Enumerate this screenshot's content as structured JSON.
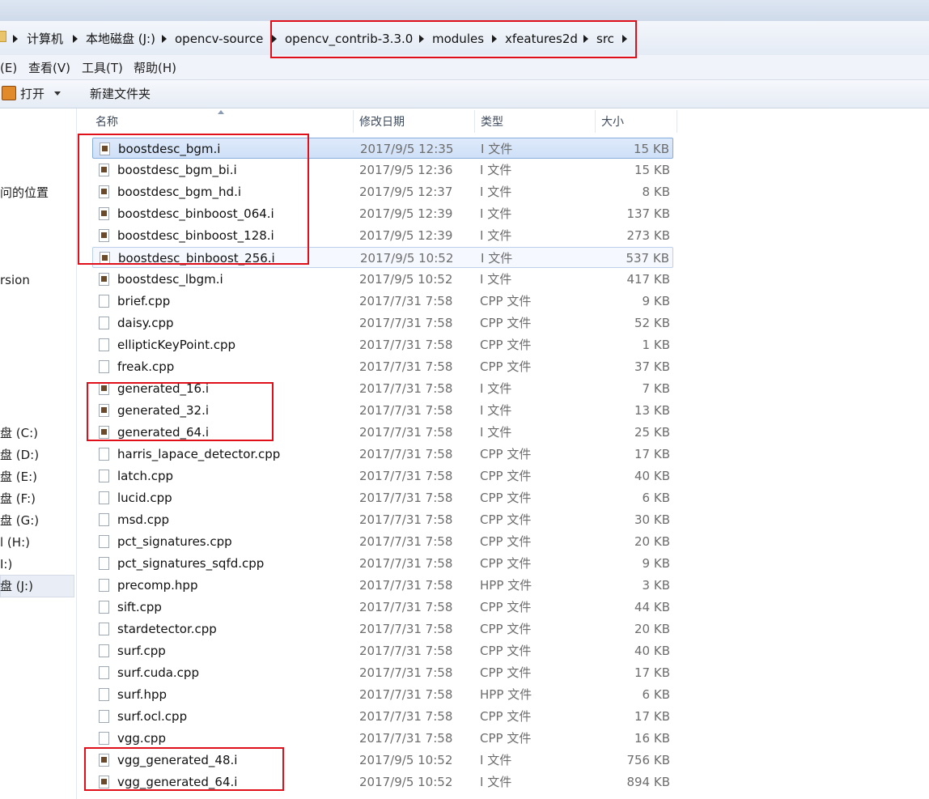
{
  "breadcrumb": {
    "items": [
      "计算机",
      "本地磁盘 (J:)",
      "opencv-source",
      "opencv_contrib-3.3.0",
      "modules",
      "xfeatures2d",
      "src"
    ]
  },
  "menu": {
    "items": [
      "(E)",
      "查看(V)",
      "工具(T)",
      "帮助(H)"
    ]
  },
  "toolbar": {
    "open_label": "打开",
    "new_folder_label": "新建文件夹"
  },
  "nav": {
    "items": [
      "问的位置",
      "rsion",
      "盘 (C:)",
      "盘 (D:)",
      "盘 (E:)",
      "盘 (F:)",
      "盘 (G:)",
      "l (H:)",
      "I:)",
      "盘 (J:)"
    ]
  },
  "columns": {
    "name": "名称",
    "date": "修改日期",
    "type": "类型",
    "size": "大小"
  },
  "files": [
    {
      "name": "boostdesc_bgm.i",
      "date": "2017/9/5 12:35",
      "type": "I 文件",
      "size": "15 KB",
      "icon": "data-file-icon",
      "state": "selected"
    },
    {
      "name": "boostdesc_bgm_bi.i",
      "date": "2017/9/5 12:36",
      "type": "I 文件",
      "size": "15 KB",
      "icon": "data-file-icon"
    },
    {
      "name": "boostdesc_bgm_hd.i",
      "date": "2017/9/5 12:37",
      "type": "I 文件",
      "size": "8 KB",
      "icon": "data-file-icon"
    },
    {
      "name": "boostdesc_binboost_064.i",
      "date": "2017/9/5 12:39",
      "type": "I 文件",
      "size": "137 KB",
      "icon": "data-file-icon"
    },
    {
      "name": "boostdesc_binboost_128.i",
      "date": "2017/9/5 12:39",
      "type": "I 文件",
      "size": "273 KB",
      "icon": "data-file-icon"
    },
    {
      "name": "boostdesc_binboost_256.i",
      "date": "2017/9/5 10:52",
      "type": "I 文件",
      "size": "537 KB",
      "icon": "data-file-icon",
      "state": "hover"
    },
    {
      "name": "boostdesc_lbgm.i",
      "date": "2017/9/5 10:52",
      "type": "I 文件",
      "size": "417 KB",
      "icon": "data-file-icon"
    },
    {
      "name": "brief.cpp",
      "date": "2017/7/31 7:58",
      "type": "CPP 文件",
      "size": "9 KB",
      "icon": "source-file-icon"
    },
    {
      "name": "daisy.cpp",
      "date": "2017/7/31 7:58",
      "type": "CPP 文件",
      "size": "52 KB",
      "icon": "source-file-icon"
    },
    {
      "name": "ellipticKeyPoint.cpp",
      "date": "2017/7/31 7:58",
      "type": "CPP 文件",
      "size": "1 KB",
      "icon": "source-file-icon"
    },
    {
      "name": "freak.cpp",
      "date": "2017/7/31 7:58",
      "type": "CPP 文件",
      "size": "37 KB",
      "icon": "source-file-icon"
    },
    {
      "name": "generated_16.i",
      "date": "2017/7/31 7:58",
      "type": "I 文件",
      "size": "7 KB",
      "icon": "data-file-icon"
    },
    {
      "name": "generated_32.i",
      "date": "2017/7/31 7:58",
      "type": "I 文件",
      "size": "13 KB",
      "icon": "data-file-icon"
    },
    {
      "name": "generated_64.i",
      "date": "2017/7/31 7:58",
      "type": "I 文件",
      "size": "25 KB",
      "icon": "data-file-icon"
    },
    {
      "name": "harris_lapace_detector.cpp",
      "date": "2017/7/31 7:58",
      "type": "CPP 文件",
      "size": "17 KB",
      "icon": "source-file-icon"
    },
    {
      "name": "latch.cpp",
      "date": "2017/7/31 7:58",
      "type": "CPP 文件",
      "size": "40 KB",
      "icon": "source-file-icon"
    },
    {
      "name": "lucid.cpp",
      "date": "2017/7/31 7:58",
      "type": "CPP 文件",
      "size": "6 KB",
      "icon": "source-file-icon"
    },
    {
      "name": "msd.cpp",
      "date": "2017/7/31 7:58",
      "type": "CPP 文件",
      "size": "30 KB",
      "icon": "source-file-icon"
    },
    {
      "name": "pct_signatures.cpp",
      "date": "2017/7/31 7:58",
      "type": "CPP 文件",
      "size": "20 KB",
      "icon": "source-file-icon"
    },
    {
      "name": "pct_signatures_sqfd.cpp",
      "date": "2017/7/31 7:58",
      "type": "CPP 文件",
      "size": "9 KB",
      "icon": "source-file-icon"
    },
    {
      "name": "precomp.hpp",
      "date": "2017/7/31 7:58",
      "type": "HPP 文件",
      "size": "3 KB",
      "icon": "header-file-icon"
    },
    {
      "name": "sift.cpp",
      "date": "2017/7/31 7:58",
      "type": "CPP 文件",
      "size": "44 KB",
      "icon": "source-file-icon"
    },
    {
      "name": "stardetector.cpp",
      "date": "2017/7/31 7:58",
      "type": "CPP 文件",
      "size": "20 KB",
      "icon": "source-file-icon"
    },
    {
      "name": "surf.cpp",
      "date": "2017/7/31 7:58",
      "type": "CPP 文件",
      "size": "40 KB",
      "icon": "source-file-icon"
    },
    {
      "name": "surf.cuda.cpp",
      "date": "2017/7/31 7:58",
      "type": "CPP 文件",
      "size": "17 KB",
      "icon": "source-file-icon"
    },
    {
      "name": "surf.hpp",
      "date": "2017/7/31 7:58",
      "type": "HPP 文件",
      "size": "6 KB",
      "icon": "header-file-icon"
    },
    {
      "name": "surf.ocl.cpp",
      "date": "2017/7/31 7:58",
      "type": "CPP 文件",
      "size": "17 KB",
      "icon": "source-file-icon"
    },
    {
      "name": "vgg.cpp",
      "date": "2017/7/31 7:58",
      "type": "CPP 文件",
      "size": "16 KB",
      "icon": "source-file-icon"
    },
    {
      "name": "vgg_generated_48.i",
      "date": "2017/9/5 10:52",
      "type": "I 文件",
      "size": "756 KB",
      "icon": "data-file-icon"
    },
    {
      "name": "vgg_generated_64.i",
      "date": "2017/9/5 10:52",
      "type": "I 文件",
      "size": "894 KB",
      "icon": "data-file-icon"
    }
  ],
  "colors": {
    "annotation_box": "#e0101a",
    "selection_border": "#84acdd",
    "secondary_text": "#6d6d6d"
  }
}
